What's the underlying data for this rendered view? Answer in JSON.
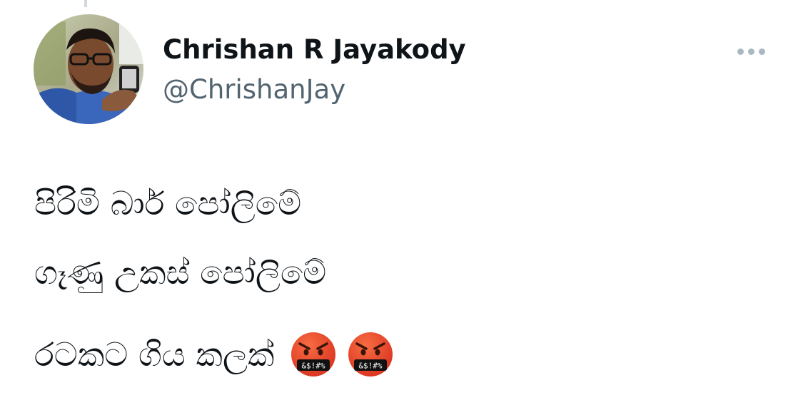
{
  "tweet": {
    "author_name": "Chrishan R Jayakody",
    "author_handle": "@ChrishanJay",
    "lines": [
      "පිරිමි බාර් පෝලිමේ",
      "ගෑණු උකස් පෝලිමේ",
      "රටකට ගිය කලක්"
    ],
    "emojis": [
      "face-with-symbols-on-mouth-icon",
      "face-with-symbols-on-mouth-icon"
    ],
    "emoji_symbol_text": "&$!#%"
  },
  "actions": {
    "more_icon": "more-horizontal-icon"
  },
  "colors": {
    "text": "#0f1419",
    "secondary_text": "#536471",
    "icon_gray": "#aab8c2",
    "emoji_red": "#e8462b"
  }
}
